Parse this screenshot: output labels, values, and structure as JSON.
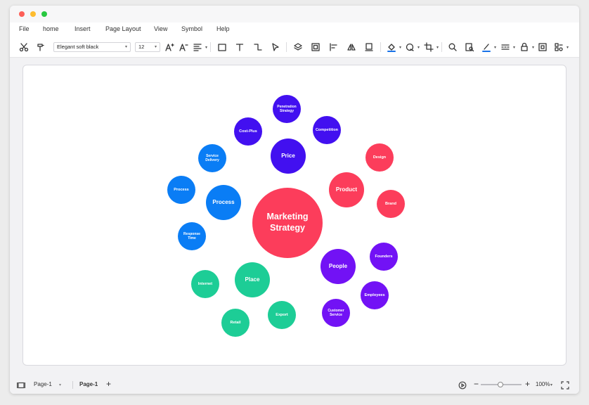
{
  "menu": [
    "File",
    "home",
    "Insert",
    "Page Layout",
    "View",
    "Symbol",
    "Help"
  ],
  "toolbar": {
    "font": "Elegant soft black",
    "size": "12",
    "icons": [
      "scissors-icon",
      "format-painter-icon",
      "font-increase-icon",
      "font-decrease-icon",
      "align-icon",
      "rectangle-icon",
      "text-icon",
      "connector-icon",
      "pointer-icon",
      "layers-icon",
      "group-icon",
      "align-left-icon",
      "flip-icon",
      "frame-icon",
      "fill-icon",
      "shape-style-icon",
      "crop-icon",
      "search-icon",
      "find-replace-icon",
      "line-color-icon",
      "line-style-icon",
      "lock-icon",
      "fit-icon",
      "more-icon"
    ]
  },
  "diagram": {
    "colors": {
      "pink": "#fc3d5b",
      "indigo": "#4210f0",
      "blue": "#0a7df5",
      "violet": "#7212f5",
      "green": "#1dcd96"
    },
    "bubbles": [
      {
        "id": "center",
        "label": "Marketing Strategy",
        "color": "pink"
      },
      {
        "id": "price",
        "label": "Price",
        "color": "indigo"
      },
      {
        "id": "penetration",
        "label": "Penetration Strategy",
        "color": "indigo"
      },
      {
        "id": "cost-plus",
        "label": "Cost-Plus",
        "color": "indigo"
      },
      {
        "id": "competition",
        "label": "Competition",
        "color": "indigo"
      },
      {
        "id": "product",
        "label": "Product",
        "color": "pink"
      },
      {
        "id": "design",
        "label": "Design",
        "color": "pink"
      },
      {
        "id": "brand",
        "label": "Brand",
        "color": "pink"
      },
      {
        "id": "process",
        "label": "Process",
        "color": "blue"
      },
      {
        "id": "service-delivery",
        "label": "Service Delivery",
        "color": "blue"
      },
      {
        "id": "process-small",
        "label": "Process",
        "color": "blue"
      },
      {
        "id": "response-time",
        "label": "Response Time",
        "color": "blue"
      },
      {
        "id": "people",
        "label": "People",
        "color": "violet"
      },
      {
        "id": "founders",
        "label": "Founders",
        "color": "violet"
      },
      {
        "id": "employees",
        "label": "Employees",
        "color": "violet"
      },
      {
        "id": "customer-service",
        "label": "Customer Service",
        "color": "violet"
      },
      {
        "id": "place",
        "label": "Place",
        "color": "green"
      },
      {
        "id": "internet",
        "label": "Internet",
        "color": "green"
      },
      {
        "id": "retail",
        "label": "Retail",
        "color": "green"
      },
      {
        "id": "export",
        "label": "Export",
        "color": "green"
      }
    ]
  },
  "status": {
    "page_dropdown": "Page-1",
    "active_tab": "Page-1",
    "add": "+",
    "zoom_minus": "−",
    "zoom_plus": "+",
    "zoom": "100%"
  }
}
